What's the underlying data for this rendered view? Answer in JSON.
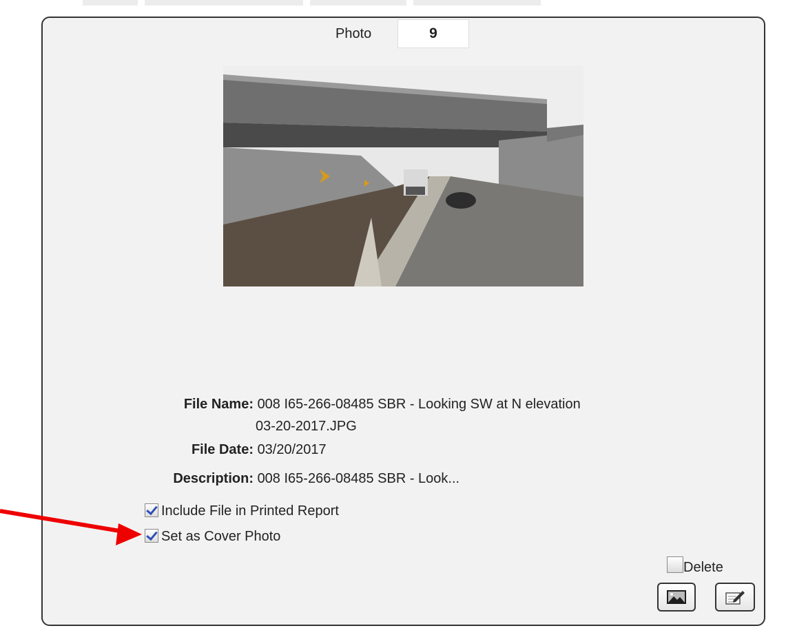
{
  "photo_header": {
    "label": "Photo",
    "number": "9"
  },
  "file_info": {
    "file_name_label": "File Name:",
    "file_name_line1": "008 I65-266-08485 SBR - Looking SW at N elevation",
    "file_name_line2": "03-20-2017.JPG",
    "file_date_label": "File Date:",
    "file_date": "03/20/2017",
    "description_label": "Description:",
    "description": "008 I65-266-08485 SBR - Look..."
  },
  "options": {
    "include_in_report": {
      "label": "Include File in Printed Report",
      "checked": true
    },
    "cover_photo": {
      "label": "Set as Cover Photo",
      "checked": true
    },
    "delete": {
      "label": "Delete",
      "checked": false
    }
  },
  "buttons": {
    "view_icon": "image-icon",
    "edit_icon": "edit-icon"
  },
  "annotation": {
    "color": "#ee0000"
  }
}
